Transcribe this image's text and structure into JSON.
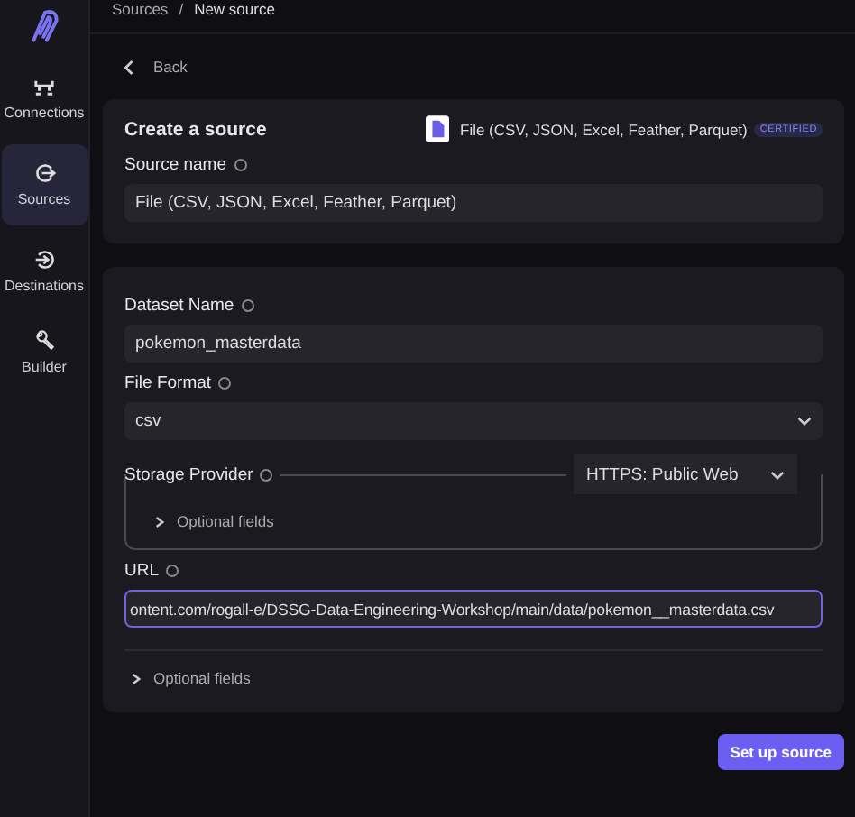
{
  "breadcrumb": {
    "items": [
      "Sources",
      "New source"
    ],
    "separator": "/"
  },
  "sidebar": {
    "items": [
      {
        "label": "Connections",
        "kind": "connections",
        "selected": false
      },
      {
        "label": "Sources",
        "kind": "sources",
        "selected": true
      },
      {
        "label": "Destinations",
        "kind": "destinations",
        "selected": false
      },
      {
        "label": "Builder",
        "kind": "builder",
        "selected": false
      }
    ]
  },
  "back": "Back",
  "source_card": {
    "title": "Create a source",
    "connector": {
      "name": "File (CSV, JSON, Excel, Feather, Parquet)",
      "badge": "CERTIFIED"
    },
    "source_name": {
      "label": "Source name",
      "value": "File (CSV, JSON, Excel, Feather, Parquet)"
    }
  },
  "config_card": {
    "dataset_name": {
      "label": "Dataset Name",
      "value": "pokemon_masterdata"
    },
    "file_format": {
      "label": "File Format",
      "value": "csv"
    },
    "storage_provider": {
      "label": "Storage Provider",
      "value": "HTTPS: Public Web",
      "optional": "Optional fields"
    },
    "url": {
      "label": "URL",
      "value": "ontent.com/rogall-e/DSSG-Data-Engineering-Workshop/main/data/pokemon__masterdata.csv"
    },
    "optional": "Optional fields"
  },
  "submit": "Set up source"
}
